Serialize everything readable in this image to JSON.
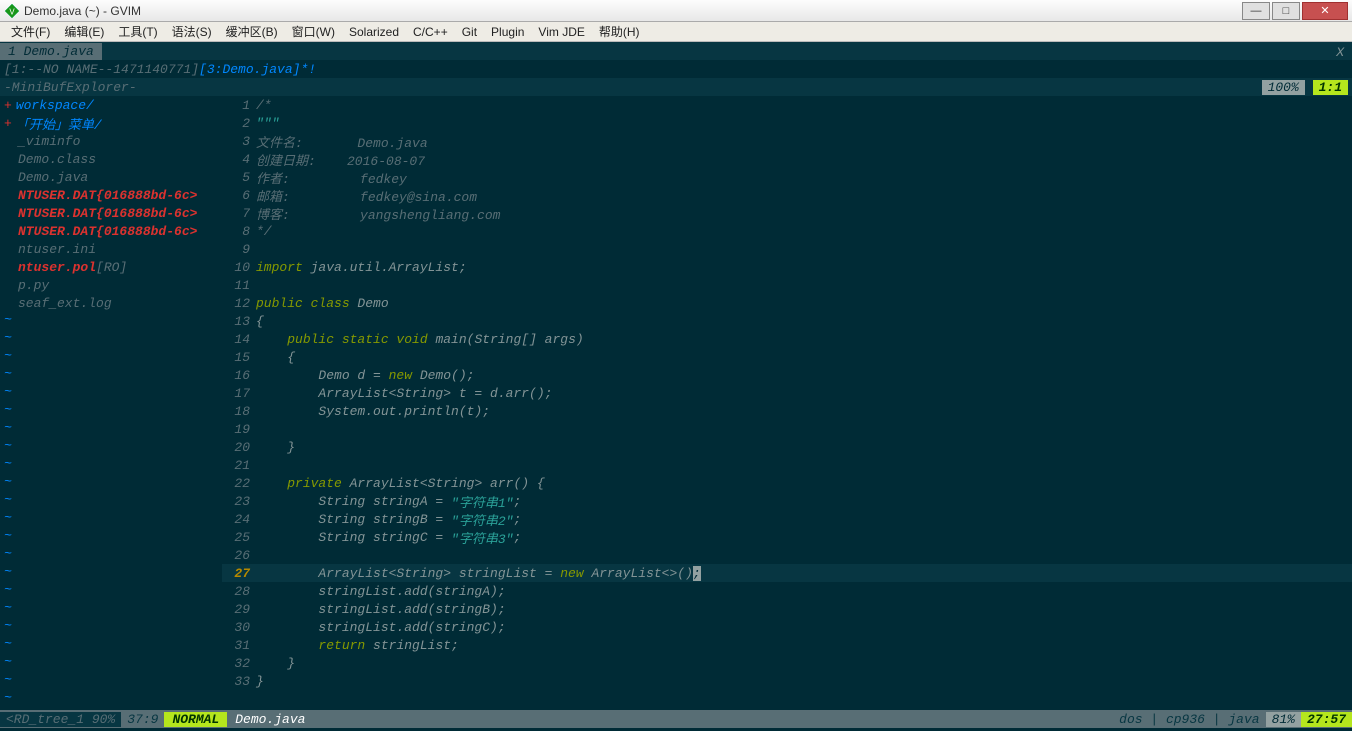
{
  "window": {
    "title": "Demo.java (~) - GVIM"
  },
  "menubar": [
    "文件(F)",
    "编辑(E)",
    "工具(T)",
    "语法(S)",
    "缓冲区(B)",
    "窗口(W)",
    "Solarized",
    "C/C++",
    "Git",
    "Plugin",
    "Vim JDE",
    "帮助(H)"
  ],
  "tabs": {
    "active": "1 Demo.java",
    "close": "X"
  },
  "bufline": {
    "left_pre": "[1:--NO NAME--1471140771]",
    "active": "[3:Demo.java]",
    "mod": "*!"
  },
  "minibuf": {
    "label": "-MiniBufExplorer-",
    "pct": "100%",
    "pos": "1:1"
  },
  "tree": {
    "items": [
      {
        "type": "dir",
        "plus": "+",
        "text": "workspace/"
      },
      {
        "type": "dir",
        "plus": "+",
        "text": "「开始」菜单/"
      },
      {
        "type": "file",
        "text": "_viminfo"
      },
      {
        "type": "file",
        "text": "Demo.class"
      },
      {
        "type": "file",
        "text": "Demo.java"
      },
      {
        "type": "red",
        "text": "NTUSER.DAT{016888bd-6c>"
      },
      {
        "type": "red",
        "text": "NTUSER.DAT{016888bd-6c>"
      },
      {
        "type": "red",
        "text": "NTUSER.DAT{016888bd-6c>"
      },
      {
        "type": "file",
        "text": "ntuser.ini"
      },
      {
        "type": "red",
        "text": "ntuser.pol",
        "suffix": " [RO]"
      },
      {
        "type": "file",
        "text": "p.py"
      },
      {
        "type": "file",
        "text": "seaf_ext.log"
      }
    ]
  },
  "code": [
    {
      "n": 1,
      "seg": [
        [
          "c-comment",
          "/*"
        ]
      ]
    },
    {
      "n": 2,
      "seg": [
        [
          "c-string",
          "\"\"\""
        ]
      ]
    },
    {
      "n": 3,
      "seg": [
        [
          "c-comment",
          "文件名:       Demo.java"
        ]
      ]
    },
    {
      "n": 4,
      "seg": [
        [
          "c-comment",
          "创建日期:    2016-08-07"
        ]
      ]
    },
    {
      "n": 5,
      "seg": [
        [
          "c-comment",
          "作者:         fedkey"
        ]
      ]
    },
    {
      "n": 6,
      "seg": [
        [
          "c-comment",
          "邮箱:         fedkey@sina.com"
        ]
      ]
    },
    {
      "n": 7,
      "seg": [
        [
          "c-comment",
          "博客:         yangshengliang.com"
        ]
      ]
    },
    {
      "n": 8,
      "seg": [
        [
          "c-comment",
          "*/"
        ]
      ]
    },
    {
      "n": 9,
      "seg": []
    },
    {
      "n": 10,
      "seg": [
        [
          "c-keyword",
          "import"
        ],
        [
          "c-ident",
          " java.util.ArrayList;"
        ]
      ]
    },
    {
      "n": 11,
      "seg": []
    },
    {
      "n": 12,
      "seg": [
        [
          "c-keyword",
          "public class"
        ],
        [
          "c-ident",
          " Demo"
        ]
      ]
    },
    {
      "n": 13,
      "seg": [
        [
          "c-ident",
          "{"
        ]
      ]
    },
    {
      "n": 14,
      "seg": [
        [
          "c-ident",
          "    "
        ],
        [
          "c-keyword",
          "public static void"
        ],
        [
          "c-ident",
          " main(String[] args)"
        ]
      ]
    },
    {
      "n": 15,
      "seg": [
        [
          "c-ident",
          "    {"
        ]
      ]
    },
    {
      "n": 16,
      "seg": [
        [
          "c-ident",
          "        Demo d = "
        ],
        [
          "c-keyword",
          "new"
        ],
        [
          "c-ident",
          " Demo();"
        ]
      ]
    },
    {
      "n": 17,
      "seg": [
        [
          "c-ident",
          "        ArrayList<String> t = d.arr();"
        ]
      ]
    },
    {
      "n": 18,
      "seg": [
        [
          "c-ident",
          "        System.out.println(t);"
        ]
      ]
    },
    {
      "n": 19,
      "seg": []
    },
    {
      "n": 20,
      "seg": [
        [
          "c-ident",
          "    }"
        ]
      ]
    },
    {
      "n": 21,
      "seg": []
    },
    {
      "n": 22,
      "seg": [
        [
          "c-ident",
          "    "
        ],
        [
          "c-keyword",
          "private"
        ],
        [
          "c-ident",
          " ArrayList<String> arr() {"
        ]
      ]
    },
    {
      "n": 23,
      "seg": [
        [
          "c-ident",
          "        String stringA = "
        ],
        [
          "c-string",
          "\"字符串1\""
        ],
        [
          "c-ident",
          ";"
        ]
      ]
    },
    {
      "n": 24,
      "seg": [
        [
          "c-ident",
          "        String stringB = "
        ],
        [
          "c-string",
          "\"字符串2\""
        ],
        [
          "c-ident",
          ";"
        ]
      ]
    },
    {
      "n": 25,
      "seg": [
        [
          "c-ident",
          "        String stringC = "
        ],
        [
          "c-string",
          "\"字符串3\""
        ],
        [
          "c-ident",
          ";"
        ]
      ]
    },
    {
      "n": 26,
      "seg": []
    },
    {
      "n": 27,
      "cur": true,
      "seg": [
        [
          "c-ident",
          "        ArrayList<String> stringList = "
        ],
        [
          "c-keyword",
          "new"
        ],
        [
          "c-ident",
          " ArrayList<>()"
        ],
        [
          "cursor",
          ";"
        ]
      ]
    },
    {
      "n": 28,
      "seg": [
        [
          "c-ident",
          "        stringList.add(stringA);"
        ]
      ]
    },
    {
      "n": 29,
      "seg": [
        [
          "c-ident",
          "        stringList.add(stringB);"
        ]
      ]
    },
    {
      "n": 30,
      "seg": [
        [
          "c-ident",
          "        stringList.add(stringC);"
        ]
      ]
    },
    {
      "n": 31,
      "seg": [
        [
          "c-ident",
          "        "
        ],
        [
          "c-keyword",
          "return"
        ],
        [
          "c-ident",
          " stringList;"
        ]
      ]
    },
    {
      "n": 32,
      "seg": [
        [
          "c-ident",
          "    }"
        ]
      ]
    },
    {
      "n": 33,
      "seg": [
        [
          "c-ident",
          "}"
        ]
      ]
    }
  ],
  "status_left": {
    "tree": "<RD_tree_1   90%",
    "treepos": "37:9"
  },
  "status_right": {
    "mode": "NORMAL",
    "filename": "Demo.java",
    "enc": "dos | cp936 | java",
    "pct": "81%",
    "pos": "27:57"
  }
}
